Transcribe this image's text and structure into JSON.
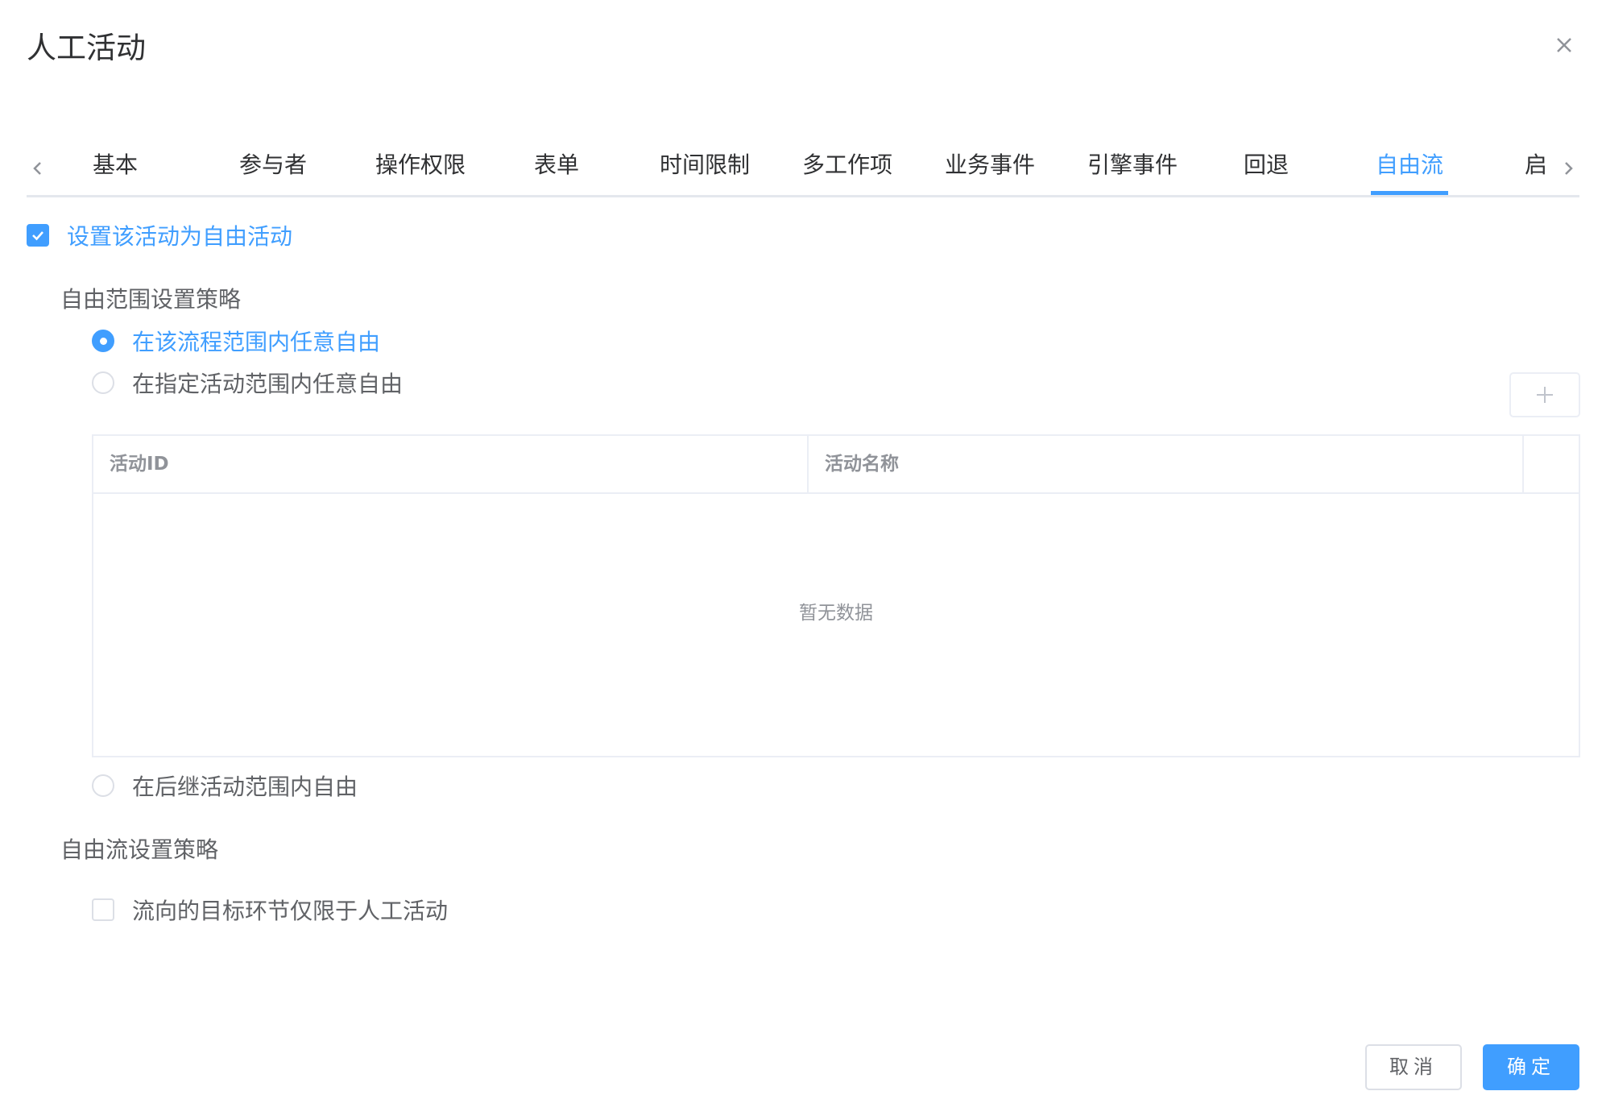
{
  "dialog": {
    "title": "人工活动",
    "close_icon": "close-icon"
  },
  "tabs": {
    "prev_icon": "chevron-left-icon",
    "next_icon": "chevron-right-icon",
    "items": [
      {
        "label": "基本"
      },
      {
        "label": "参与者"
      },
      {
        "label": "操作权限"
      },
      {
        "label": "表单"
      },
      {
        "label": "时间限制"
      },
      {
        "label": "多工作项"
      },
      {
        "label": "业务事件"
      },
      {
        "label": "引擎事件"
      },
      {
        "label": "回退"
      },
      {
        "label": "自由流"
      },
      {
        "label": "启"
      }
    ],
    "active": "自由流"
  },
  "free_activity": {
    "checked": true,
    "label": "设置该活动为自由活动"
  },
  "scope_strategy": {
    "heading": "自由范围设置策略",
    "options": [
      {
        "label": "在该流程范围内任意自由",
        "selected": true
      },
      {
        "label": "在指定活动范围内任意自由",
        "selected": false
      },
      {
        "label": "在后继活动范围内自由",
        "selected": false
      }
    ]
  },
  "activity_table": {
    "columns": [
      "活动ID",
      "活动名称",
      ""
    ],
    "rows": [],
    "empty_text": "暂无数据",
    "add_icon": "plus-icon"
  },
  "flow_strategy": {
    "heading": "自由流设置策略",
    "option": {
      "label": "流向的目标环节仅限于人工活动",
      "checked": false
    }
  },
  "footer": {
    "cancel_label": "取消",
    "confirm_label": "确定"
  },
  "colors": {
    "primary": "#409eff",
    "text": "#303133",
    "muted": "#909399",
    "border": "#ebeef5"
  }
}
